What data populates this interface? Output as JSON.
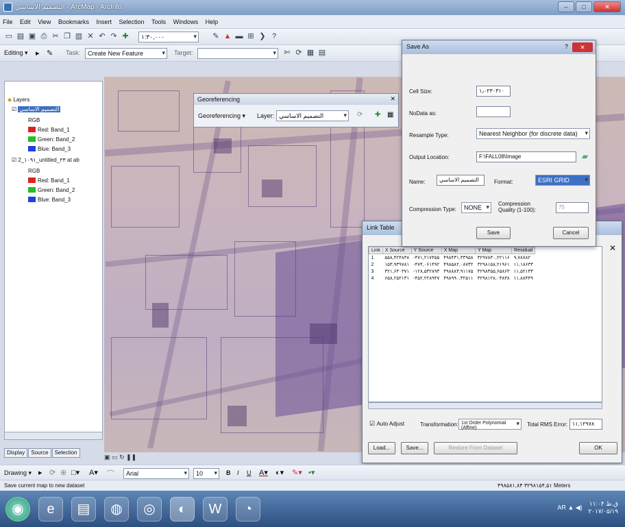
{
  "window": {
    "title": "التصميم الاساسي - ArcMap - ArcInfo"
  },
  "menu": [
    "File",
    "Edit",
    "View",
    "Bookmarks",
    "Insert",
    "Selection",
    "Tools",
    "Windows",
    "Help"
  ],
  "toolbar": {
    "scale": "۱:۳۰,۰۰۰",
    "editor_label": "Editing ▾",
    "task_label": "Task:",
    "task_value": "Create New Feature",
    "target_label": "Target:"
  },
  "toc": {
    "root": "Layers",
    "layers": [
      {
        "name": "التصميم الاساسي",
        "rgb": "RGB",
        "bands": [
          "Red: Band_1",
          "Green: Band_2",
          "Blue: Band_3"
        ]
      },
      {
        "name": "2_۱۰۹۱_untitled_۲۳ at ab",
        "rgb": "RGB",
        "bands": [
          "Red: Band_1",
          "Green: Band_2",
          "Blue: Band_3"
        ]
      }
    ],
    "tabs": [
      "Display",
      "Source",
      "Selection"
    ]
  },
  "georeferencing": {
    "title": "Georeferencing",
    "menu_label": "Georeferencing ▾",
    "layer_label": "Layer:",
    "layer_value": "التصميم الاساسي"
  },
  "save_as": {
    "title": "Save As",
    "cell_size_label": "Cell Size:",
    "cell_size_value": "۱٫۰۲۳۰۳۱۰",
    "nodata_label": "NoData as:",
    "nodata_value": "",
    "resample_label": "Resample Type:",
    "resample_value": "Nearest Neighbor (for discrete data)",
    "output_label": "Output Location:",
    "output_value": "F:\\FALL08\\Image",
    "name_label": "Name:",
    "name_value": "التصميم الاساسي",
    "format_label": "Format:",
    "format_value": "ESRI GRID",
    "compression_label": "Compression Type:",
    "compression_value": "NONE",
    "quality_label": "Compression Quality (1-100):",
    "quality_value": "75",
    "save_button": "Save",
    "cancel_button": "Cancel"
  },
  "link_table": {
    "title": "Link Table",
    "columns": [
      "Link",
      "X Source",
      "Y Source",
      "X Map",
      "Y Map",
      "Residual"
    ],
    "rows": [
      [
        "1",
        "۵۵۸,۴۲۴۸۳۸",
        "-۴۷۱,۲۱۷۴۵۵",
        "۴۹۸۴۳۱,۳۳۹۵۸",
        "۳۲۹۷۸۳۰,۲۲۱۱۶",
        "۹,۷۸۷۸۲"
      ],
      [
        "2",
        "۱۵۳,۹۳۹۷۸۱",
        "-۴۷۴,۰۶۱۴۹۲",
        "۴۹۸۵۸۲,۰۸۷۳۲",
        "۳۲۹۸۱۵۸,۲۱۹۶۱",
        "۱۱,۱۸۶۳۳"
      ],
      [
        "3",
        "۳۲۱,۶۳۰۳۷۱",
        "-۱۲۸,۵۳۲۸۹۳",
        "۴۹۸۸۸۳,۹۱۱۷۵",
        "۳۲۹۸۳۵۵,۶۵۸۶۳",
        "۱۱,۵۲۱۳۳"
      ],
      [
        "4",
        "۶۵۸,۲۵۲۱۳۱",
        "-۴۵۲,۲۲۸۹۴۷",
        "۴۹۸۹۹۰,۳۲۵۱۱",
        "۳۲۹۸۱۲۸,۰۳۸۳۸",
        "۱۱,۸۸۴۴۹"
      ]
    ],
    "auto_adjust_label": "Auto Adjust",
    "transformation_label": "Transformation:",
    "transformation_value": "1st Order Polynomial (Affine)",
    "rms_label": "Total RMS Error:",
    "rms_value": "۱۱,۱۲۹۷۸",
    "load_button": "Load...",
    "save_button": "Save...",
    "restore_button": "Restore From Dataset",
    "ok_button": "OK"
  },
  "drawing": {
    "drawing_label": "Drawing ▾",
    "font": "Arial",
    "font_size": "10",
    "bold": "B",
    "italic": "I",
    "underline": "U"
  },
  "status": {
    "message": "Save current map to new dataset",
    "coords": "۴۹۸۵۸۱,۸۴ ۳۲۹۸۱۵۴,۵۱ Meters"
  },
  "taskbar": {
    "apps": [
      "start",
      "ie",
      "explorer",
      "firefox",
      "chrome",
      "arcmap",
      "word",
      "other"
    ],
    "time": "۱۱:۰۴ ق.ظ",
    "date": "۲۰۱۷/۰۵/۱۹"
  }
}
